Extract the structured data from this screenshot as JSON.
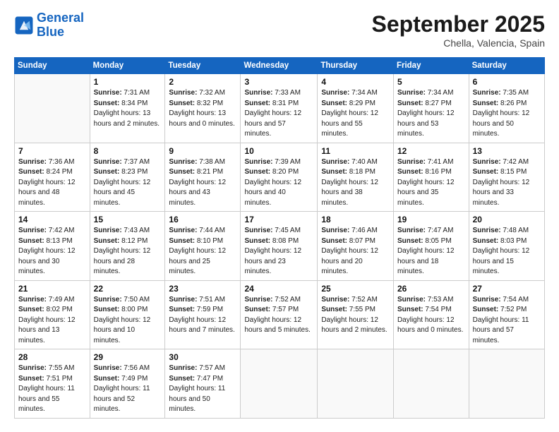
{
  "header": {
    "logo_line1": "General",
    "logo_line2": "Blue",
    "month": "September 2025",
    "location": "Chella, Valencia, Spain"
  },
  "weekdays": [
    "Sunday",
    "Monday",
    "Tuesday",
    "Wednesday",
    "Thursday",
    "Friday",
    "Saturday"
  ],
  "weeks": [
    [
      {
        "day": "",
        "sunrise": "",
        "sunset": "",
        "daylight": ""
      },
      {
        "day": "1",
        "sunrise": "7:31 AM",
        "sunset": "8:34 PM",
        "daylight": "13 hours and 2 minutes."
      },
      {
        "day": "2",
        "sunrise": "7:32 AM",
        "sunset": "8:32 PM",
        "daylight": "13 hours and 0 minutes."
      },
      {
        "day": "3",
        "sunrise": "7:33 AM",
        "sunset": "8:31 PM",
        "daylight": "12 hours and 57 minutes."
      },
      {
        "day": "4",
        "sunrise": "7:34 AM",
        "sunset": "8:29 PM",
        "daylight": "12 hours and 55 minutes."
      },
      {
        "day": "5",
        "sunrise": "7:34 AM",
        "sunset": "8:27 PM",
        "daylight": "12 hours and 53 minutes."
      },
      {
        "day": "6",
        "sunrise": "7:35 AM",
        "sunset": "8:26 PM",
        "daylight": "12 hours and 50 minutes."
      }
    ],
    [
      {
        "day": "7",
        "sunrise": "7:36 AM",
        "sunset": "8:24 PM",
        "daylight": "12 hours and 48 minutes."
      },
      {
        "day": "8",
        "sunrise": "7:37 AM",
        "sunset": "8:23 PM",
        "daylight": "12 hours and 45 minutes."
      },
      {
        "day": "9",
        "sunrise": "7:38 AM",
        "sunset": "8:21 PM",
        "daylight": "12 hours and 43 minutes."
      },
      {
        "day": "10",
        "sunrise": "7:39 AM",
        "sunset": "8:20 PM",
        "daylight": "12 hours and 40 minutes."
      },
      {
        "day": "11",
        "sunrise": "7:40 AM",
        "sunset": "8:18 PM",
        "daylight": "12 hours and 38 minutes."
      },
      {
        "day": "12",
        "sunrise": "7:41 AM",
        "sunset": "8:16 PM",
        "daylight": "12 hours and 35 minutes."
      },
      {
        "day": "13",
        "sunrise": "7:42 AM",
        "sunset": "8:15 PM",
        "daylight": "12 hours and 33 minutes."
      }
    ],
    [
      {
        "day": "14",
        "sunrise": "7:42 AM",
        "sunset": "8:13 PM",
        "daylight": "12 hours and 30 minutes."
      },
      {
        "day": "15",
        "sunrise": "7:43 AM",
        "sunset": "8:12 PM",
        "daylight": "12 hours and 28 minutes."
      },
      {
        "day": "16",
        "sunrise": "7:44 AM",
        "sunset": "8:10 PM",
        "daylight": "12 hours and 25 minutes."
      },
      {
        "day": "17",
        "sunrise": "7:45 AM",
        "sunset": "8:08 PM",
        "daylight": "12 hours and 23 minutes."
      },
      {
        "day": "18",
        "sunrise": "7:46 AM",
        "sunset": "8:07 PM",
        "daylight": "12 hours and 20 minutes."
      },
      {
        "day": "19",
        "sunrise": "7:47 AM",
        "sunset": "8:05 PM",
        "daylight": "12 hours and 18 minutes."
      },
      {
        "day": "20",
        "sunrise": "7:48 AM",
        "sunset": "8:03 PM",
        "daylight": "12 hours and 15 minutes."
      }
    ],
    [
      {
        "day": "21",
        "sunrise": "7:49 AM",
        "sunset": "8:02 PM",
        "daylight": "12 hours and 13 minutes."
      },
      {
        "day": "22",
        "sunrise": "7:50 AM",
        "sunset": "8:00 PM",
        "daylight": "12 hours and 10 minutes."
      },
      {
        "day": "23",
        "sunrise": "7:51 AM",
        "sunset": "7:59 PM",
        "daylight": "12 hours and 7 minutes."
      },
      {
        "day": "24",
        "sunrise": "7:52 AM",
        "sunset": "7:57 PM",
        "daylight": "12 hours and 5 minutes."
      },
      {
        "day": "25",
        "sunrise": "7:52 AM",
        "sunset": "7:55 PM",
        "daylight": "12 hours and 2 minutes."
      },
      {
        "day": "26",
        "sunrise": "7:53 AM",
        "sunset": "7:54 PM",
        "daylight": "12 hours and 0 minutes."
      },
      {
        "day": "27",
        "sunrise": "7:54 AM",
        "sunset": "7:52 PM",
        "daylight": "11 hours and 57 minutes."
      }
    ],
    [
      {
        "day": "28",
        "sunrise": "7:55 AM",
        "sunset": "7:51 PM",
        "daylight": "11 hours and 55 minutes."
      },
      {
        "day": "29",
        "sunrise": "7:56 AM",
        "sunset": "7:49 PM",
        "daylight": "11 hours and 52 minutes."
      },
      {
        "day": "30",
        "sunrise": "7:57 AM",
        "sunset": "7:47 PM",
        "daylight": "11 hours and 50 minutes."
      },
      {
        "day": "",
        "sunrise": "",
        "sunset": "",
        "daylight": ""
      },
      {
        "day": "",
        "sunrise": "",
        "sunset": "",
        "daylight": ""
      },
      {
        "day": "",
        "sunrise": "",
        "sunset": "",
        "daylight": ""
      },
      {
        "day": "",
        "sunrise": "",
        "sunset": "",
        "daylight": ""
      }
    ]
  ],
  "labels": {
    "sunrise": "Sunrise:",
    "sunset": "Sunset:",
    "daylight": "Daylight hours"
  }
}
